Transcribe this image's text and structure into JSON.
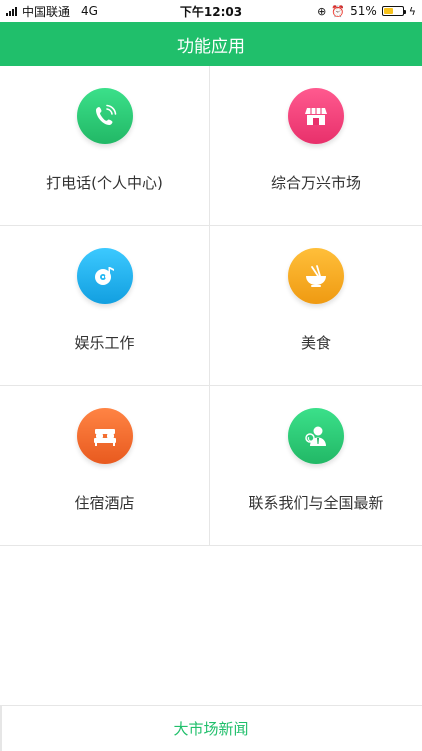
{
  "status_bar": {
    "carrier": "中国联通",
    "network": "4G",
    "time": "下午12:03",
    "battery": "51%",
    "battery_level": 0.51,
    "icons": [
      "signal-icon",
      "orientation-lock-icon",
      "alarm-icon",
      "battery-icon",
      "charging-icon"
    ]
  },
  "header": {
    "title": "功能应用"
  },
  "menu": [
    {
      "label": "打电话(个人中心)",
      "icon": "phone-icon",
      "color": "#2ecc71"
    },
    {
      "label": "综合万兴市场",
      "icon": "store-icon",
      "color": "#f0437b"
    },
    {
      "label": "娱乐工作",
      "icon": "music-disc-icon",
      "color": "#1fb7f2"
    },
    {
      "label": "美食",
      "icon": "bowl-icon",
      "color": "#f5a623"
    },
    {
      "label": "住宿酒店",
      "icon": "bed-icon",
      "color": "#f26b2e"
    },
    {
      "label": "联系我们与全国最新",
      "icon": "contact-support-icon",
      "color": "#2ecc71"
    }
  ],
  "bottom_tab": {
    "label": "大市场新闻"
  },
  "colors": {
    "primary": "#20bf6b"
  }
}
